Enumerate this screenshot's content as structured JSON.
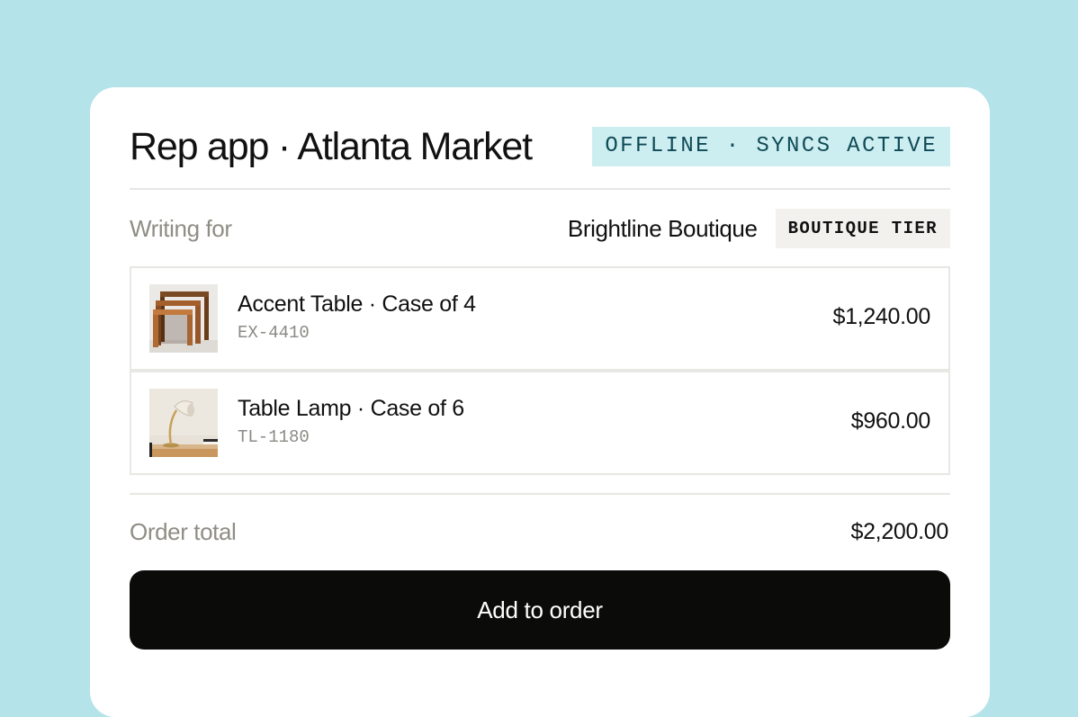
{
  "header": {
    "title": "Rep app · Atlanta Market",
    "status": "OFFLINE · SYNCS ACTIVE"
  },
  "customer": {
    "label": "Writing for",
    "name": "Brightline Boutique",
    "tier": "BOUTIQUE TIER"
  },
  "items": [
    {
      "name": "Accent Table · Case of 4",
      "sku": "EX-4410",
      "price": "$1,240.00",
      "thumbnail": "nesting-tables-photo"
    },
    {
      "name": "Table Lamp · Case of 6",
      "sku": "TL-1180",
      "price": "$960.00",
      "thumbnail": "table-lamp-photo"
    }
  ],
  "summary": {
    "label": "Order total",
    "value": "$2,200.00"
  },
  "actions": {
    "primary_label": "Add to order"
  },
  "colors": {
    "background": "#b4e3ea",
    "status_badge_bg": "#cdeef1",
    "status_badge_text": "#0f4a56",
    "tier_badge_bg": "#f2f1ee",
    "primary_button": "#0b0b0a",
    "muted_text": "#8f8d84"
  }
}
